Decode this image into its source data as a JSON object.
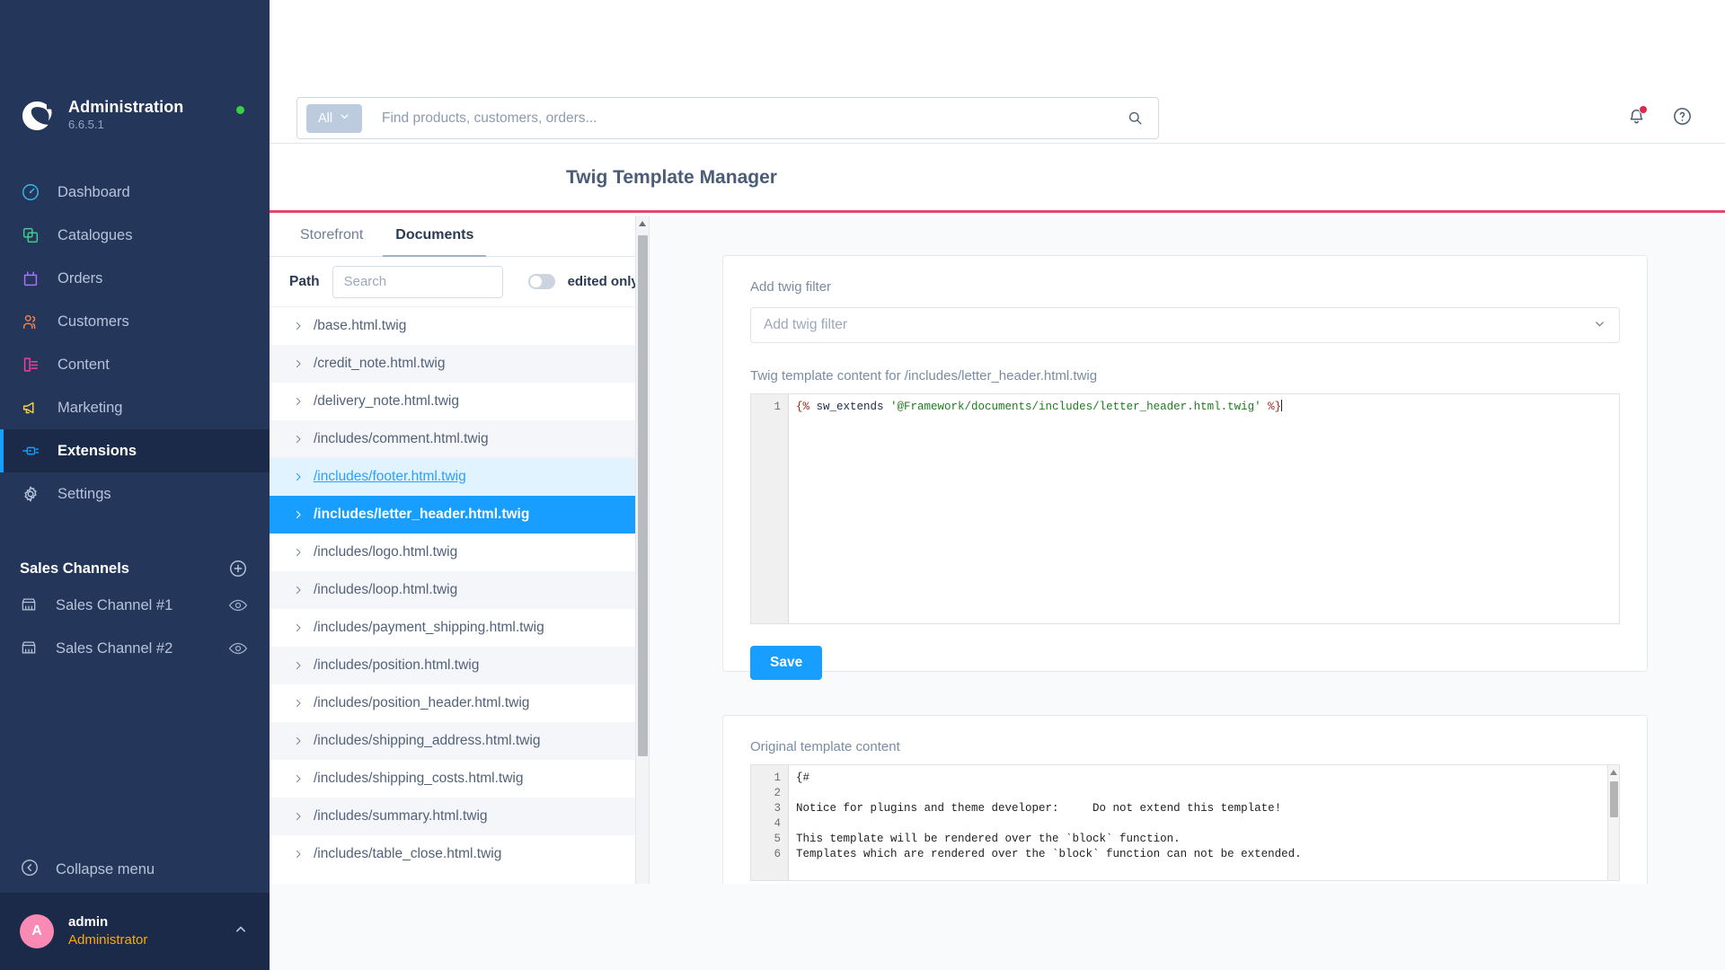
{
  "sidebar": {
    "brand": {
      "title": "Administration",
      "version": "6.6.5.1",
      "logo_icon": "shopware-logo-icon",
      "status_icon": "status-online-dot"
    },
    "items": [
      {
        "label": "Dashboard",
        "icon": "dashboard-icon",
        "color": "#37b6e4",
        "active": false
      },
      {
        "label": "Catalogues",
        "icon": "catalogue-icon",
        "color": "#3ecf8e",
        "active": false
      },
      {
        "label": "Orders",
        "icon": "orders-bag-icon",
        "color": "#a972f7",
        "active": false
      },
      {
        "label": "Customers",
        "icon": "customers-icon",
        "color": "#f2814a",
        "active": false
      },
      {
        "label": "Content",
        "icon": "content-icon",
        "color": "#f2409a",
        "active": false
      },
      {
        "label": "Marketing",
        "icon": "marketing-megaphone-icon",
        "color": "#f5d察",
        "active": false
      },
      {
        "label": "Extensions",
        "icon": "extensions-plug-icon",
        "color": "#189eff",
        "active": true
      },
      {
        "label": "Settings",
        "icon": "settings-gear-icon",
        "color": "#b6c4da",
        "active": false
      }
    ],
    "sales_channels": {
      "title": "Sales Channels",
      "add_icon": "add-circle-icon",
      "items": [
        {
          "label": "Sales Channel #1",
          "icon": "storefront-icon",
          "eye_icon": "eye-icon"
        },
        {
          "label": "Sales Channel #2",
          "icon": "storefront-icon",
          "eye_icon": "eye-icon"
        }
      ]
    },
    "collapse": {
      "label": "Collapse menu",
      "icon": "collapse-left-icon"
    },
    "user": {
      "initial": "A",
      "name": "admin",
      "role": "Administrator",
      "caret_icon": "chevron-up-icon"
    }
  },
  "topbar": {
    "search": {
      "scope_label": "All",
      "scope_caret_icon": "chevron-down-icon",
      "placeholder": "Find products, customers, orders...",
      "value": "",
      "search_icon": "search-icon"
    },
    "notifications_icon": "bell-icon",
    "notifications_badge": true,
    "help_icon": "help-circle-icon"
  },
  "page": {
    "title": "Twig Template Manager",
    "accent_color": "#e5476d"
  },
  "filepanel": {
    "tabs": [
      {
        "label": "Storefront",
        "active": false
      },
      {
        "label": "Documents",
        "active": true
      }
    ],
    "path_label": "Path",
    "search_placeholder": "Search",
    "search_value": "",
    "toggle_label": "edited only",
    "toggle_on": false,
    "files": [
      {
        "name": "/base.html.twig",
        "state": "normal"
      },
      {
        "name": "/credit_note.html.twig",
        "state": "normal"
      },
      {
        "name": "/delivery_note.html.twig",
        "state": "normal"
      },
      {
        "name": "/includes/comment.html.twig",
        "state": "normal"
      },
      {
        "name": "/includes/footer.html.twig",
        "state": "hovered"
      },
      {
        "name": "/includes/letter_header.html.twig",
        "state": "selected"
      },
      {
        "name": "/includes/logo.html.twig",
        "state": "normal"
      },
      {
        "name": "/includes/loop.html.twig",
        "state": "normal"
      },
      {
        "name": "/includes/payment_shipping.html.twig",
        "state": "normal"
      },
      {
        "name": "/includes/position.html.twig",
        "state": "normal"
      },
      {
        "name": "/includes/position_header.html.twig",
        "state": "normal"
      },
      {
        "name": "/includes/shipping_address.html.twig",
        "state": "normal"
      },
      {
        "name": "/includes/shipping_costs.html.twig",
        "state": "normal"
      },
      {
        "name": "/includes/summary.html.twig",
        "state": "normal"
      },
      {
        "name": "/includes/table_close.html.twig",
        "state": "normal"
      }
    ]
  },
  "editor": {
    "filter_label": "Add twig filter",
    "filter_placeholder": "Add twig filter",
    "filter_value": "",
    "filter_caret_icon": "chevron-down-icon",
    "content_label": "Twig template content for /includes/letter_header.html.twig",
    "code_line_number": "1",
    "code_open_tag": "{%",
    "code_keyword": " sw_extends ",
    "code_string": "'@Framework/documents/includes/letter_header.html.twig'",
    "code_close_tag": " %}",
    "save_label": "Save"
  },
  "original": {
    "label": "Original template content",
    "lines": [
      {
        "n": "1",
        "text": "{#"
      },
      {
        "n": "2",
        "text": ""
      },
      {
        "n": "3",
        "text": "Notice for plugins and theme developer:     Do not extend this template!"
      },
      {
        "n": "4",
        "text": ""
      },
      {
        "n": "5",
        "text": "This template will be rendered over the `block` function."
      },
      {
        "n": "6",
        "text": "Templates which are rendered over the `block` function can not be extended."
      }
    ]
  }
}
